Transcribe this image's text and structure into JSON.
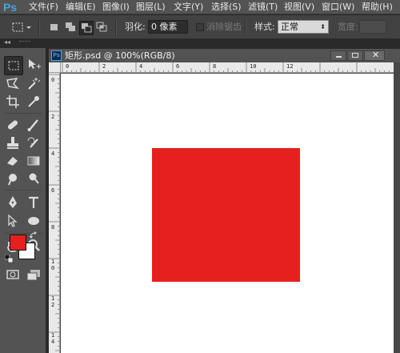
{
  "app": {
    "logo": "Ps"
  },
  "menus": [
    "文件(F)",
    "编辑(E)",
    "图像(I)",
    "图层(L)",
    "文字(Y)",
    "选择(S)",
    "滤镜(T)",
    "视图(V)",
    "窗口(W)",
    "帮助(H)"
  ],
  "options": {
    "feather_label": "羽化:",
    "feather_value": "0 像素",
    "antialias_label": "消除锯齿",
    "style_label": "样式:",
    "style_value": "正常",
    "width_label": "宽度:"
  },
  "document": {
    "title": "矩形.psd @ 100%(RGB/8)",
    "minimize": "▁",
    "maximize": "□",
    "close": "✕"
  },
  "ruler": {
    "h_ticks": [
      "0",
      "2",
      "4",
      "6",
      "8",
      "10",
      "12"
    ],
    "v_ticks": [
      [
        "0"
      ],
      [
        "2"
      ],
      [
        "4"
      ],
      [
        "6"
      ],
      [
        "8"
      ],
      [
        "1",
        "0"
      ],
      [
        "1",
        "2"
      ],
      [
        "1",
        "4"
      ]
    ]
  },
  "colors": {
    "foreground": "#e5201f",
    "background": "#ffffff",
    "shape_fill": "#e5201f",
    "canvas": "#ffffff"
  },
  "icons": {
    "marquee": "marquee-icon",
    "move": "move-icon",
    "lasso": "lasso-icon",
    "magic_wand": "magic-wand-icon",
    "crop": "crop-icon",
    "eyedropper": "eyedropper-icon",
    "healing": "healing-brush-icon",
    "brush": "brush-icon",
    "stamp": "clone-stamp-icon",
    "history_brush": "history-brush-icon",
    "eraser": "eraser-icon",
    "gradient": "gradient-icon",
    "blur": "blur-icon",
    "dodge": "dodge-icon",
    "pen": "pen-icon",
    "type": "type-icon",
    "path_select": "path-select-icon",
    "ellipse": "ellipse-icon",
    "hand": "hand-icon",
    "zoom": "zoom-icon",
    "quick_mask": "quick-mask-icon",
    "screen_mode": "screen-mode-icon"
  }
}
